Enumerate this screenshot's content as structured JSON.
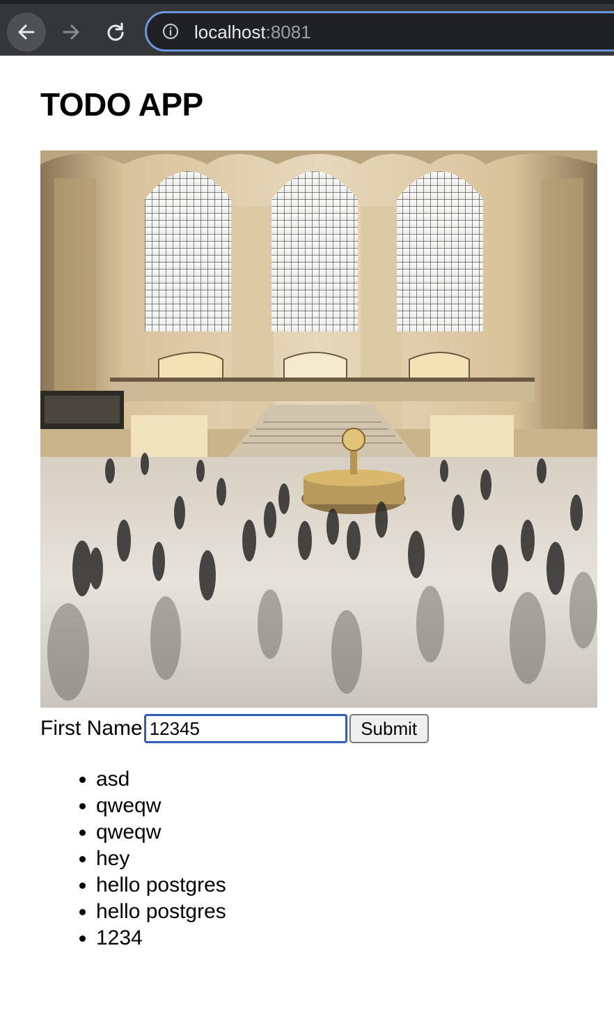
{
  "browser": {
    "url_host": "localhost",
    "url_port": ":8081",
    "icons": {
      "back": "arrow-left-icon",
      "forward": "arrow-right-icon",
      "reload": "reload-icon",
      "site_info": "info-circle-icon"
    }
  },
  "page": {
    "title": "TODO APP",
    "image": {
      "subject": "photo"
    },
    "form": {
      "label": "First Name",
      "input_value": "12345",
      "submit_label": "Submit"
    },
    "todos": [
      "asd",
      "qweqw",
      "qweqw",
      "hey",
      "hello postgres",
      "hello postgres",
      "1234"
    ]
  },
  "colors": {
    "chrome_bg": "#35363a",
    "omnibox_border": "#6e96dd",
    "input_focus_border": "#2f5fb8"
  }
}
